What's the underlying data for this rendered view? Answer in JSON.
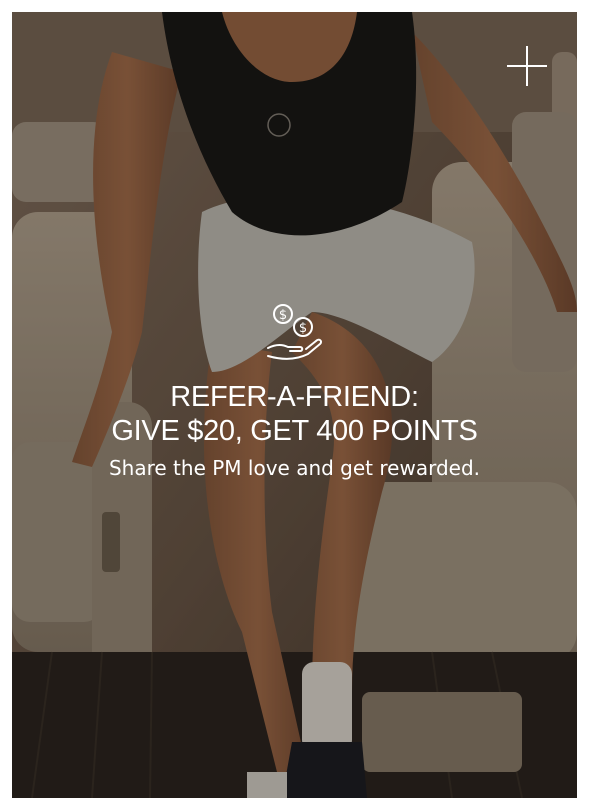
{
  "modal": {
    "headline_line1": "REFER-A-FRIEND:",
    "headline_line2": "GIVE $20, GET 400 POINTS",
    "subtitle": "Share the PM love and get rewarded.",
    "close_icon": "plus-close-icon",
    "feature_icon": "hand-coins-icon"
  },
  "colors": {
    "text": "#ffffff",
    "overlay_tint": "#5a4636",
    "top_accent": "#000000"
  }
}
